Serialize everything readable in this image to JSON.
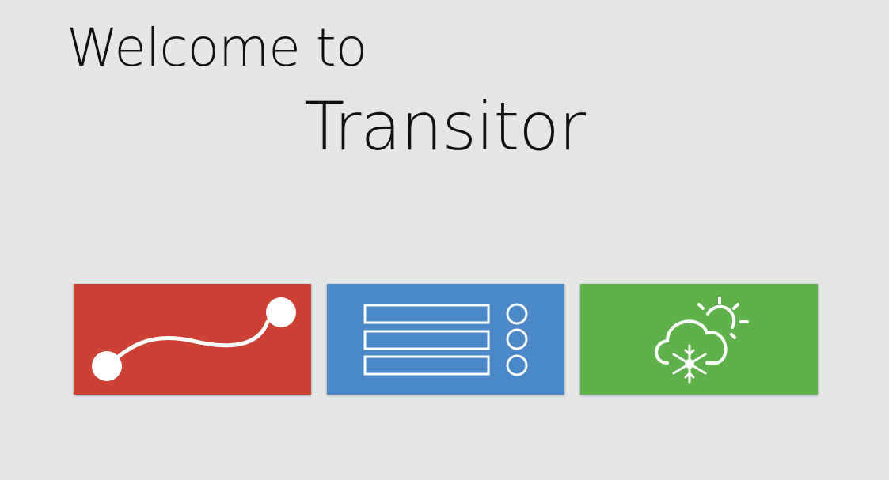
{
  "header": {
    "welcome_text": "Welcome to",
    "app_name": "Transitor"
  },
  "tiles": [
    {
      "name": "route",
      "icon": "route-icon",
      "color": "#cc4133"
    },
    {
      "name": "list",
      "icon": "list-icon",
      "color": "#4a88c7"
    },
    {
      "name": "weather",
      "icon": "weather-icon",
      "color": "#5fb14b"
    }
  ]
}
